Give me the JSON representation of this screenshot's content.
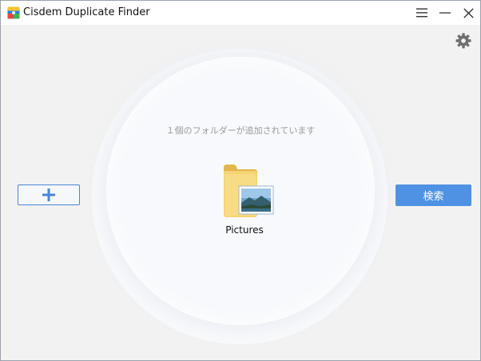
{
  "window": {
    "title": "Cisdem Duplicate Finder"
  },
  "titlebar_controls": {
    "menu_icon": "hamburger-menu-icon",
    "minimize_icon": "minimize-icon",
    "close_icon": "close-icon"
  },
  "toolbar": {
    "settings_icon": "gear-icon"
  },
  "main": {
    "status_text": "１個のフォルダーが追加されています",
    "folders": [
      {
        "label": "Pictures",
        "icon": "pictures-folder-icon"
      }
    ],
    "add_button_icon": "plus-icon",
    "search_label": "検索"
  },
  "colors": {
    "accent": "#4f92e3",
    "add_border": "#4a86d1",
    "background": "#f3f2f2",
    "circle": "#f8f9fc"
  }
}
